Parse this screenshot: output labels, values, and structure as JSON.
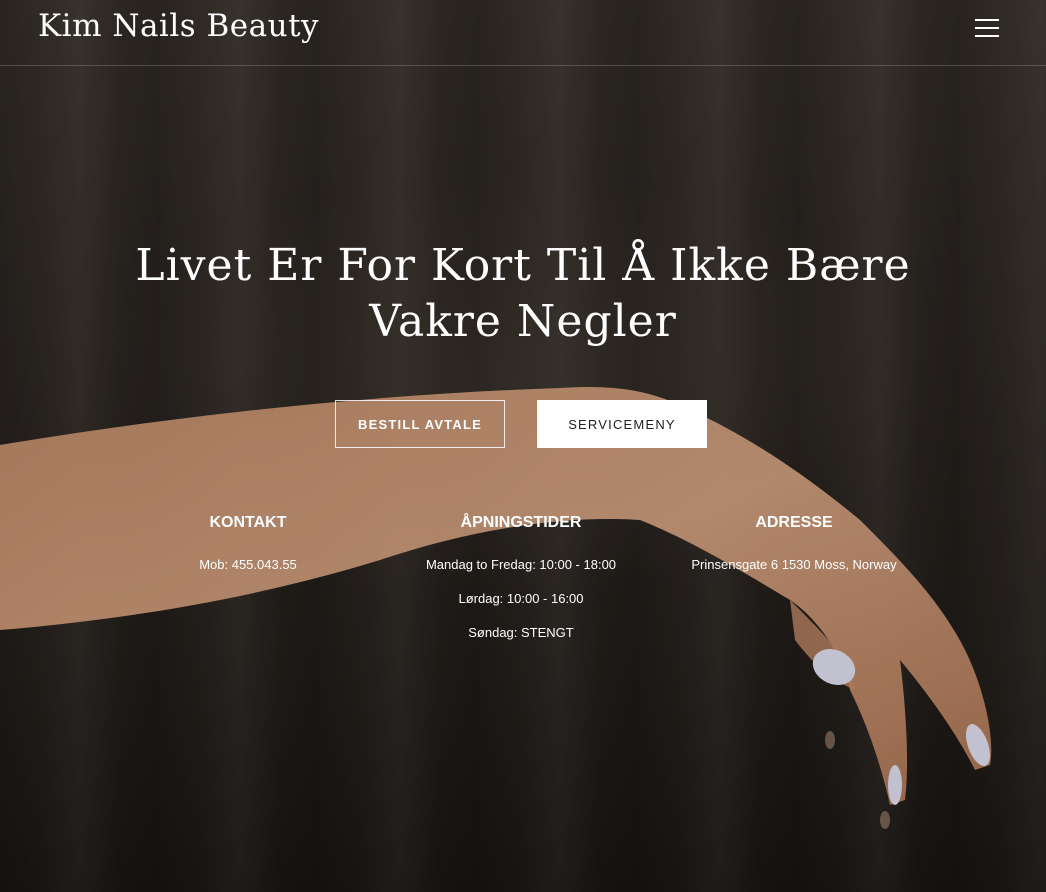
{
  "header": {
    "logo": "Kim Nails Beauty",
    "menu_icon": "hamburger-menu-icon"
  },
  "hero": {
    "headline": "Livet Er For Kort Til Å Ikke Bære Vakre Negler",
    "book_button": "BESTILL AVTALE",
    "menu_button": "SERVICEMENY"
  },
  "info": {
    "contact": {
      "title": "KONTAKT",
      "phone": "Mob: 455.043.55"
    },
    "hours": {
      "title": "ÅPNINGSTIDER",
      "weekdays": "Mandag to Fredag: 10:00 - 18:00",
      "saturday": "Lørdag: 10:00 - 16:00",
      "sunday": "Søndag: STENGT"
    },
    "address": {
      "title": "ADRESSE",
      "line": "Prinsensgate 6 1530 Moss, Norway"
    }
  },
  "colors": {
    "background": "#2a2622",
    "skin": "#d6a27e",
    "nail": "#dcdcec",
    "text": "#ffffff"
  }
}
